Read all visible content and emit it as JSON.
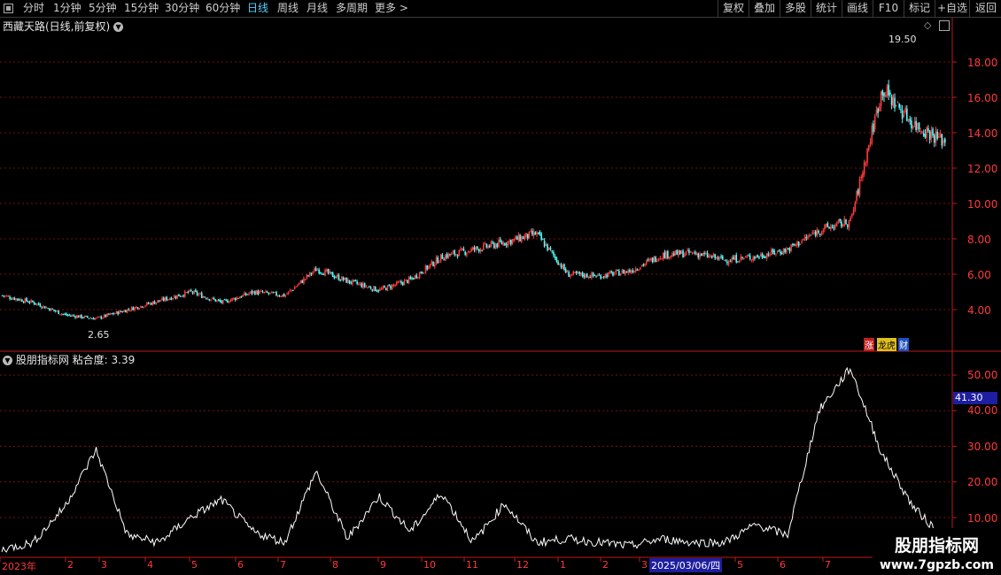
{
  "toolbar": {
    "periods": [
      "分时",
      "1分钟",
      "5分钟",
      "15分钟",
      "30分钟",
      "60分钟",
      "日线",
      "周线",
      "月线",
      "多周期",
      "更多 >"
    ],
    "active_period": "日线",
    "actions": [
      "复权",
      "叠加",
      "多股",
      "统计",
      "画线",
      "F10",
      "标记",
      "+自选",
      "返回"
    ]
  },
  "main_chart": {
    "title": "西藏天路(日线,前复权)",
    "high_label": "19.50",
    "low_label": "2.65",
    "y_ticks": [
      "18.00",
      "16.00",
      "14.00",
      "12.00",
      "10.00",
      "8.00",
      "6.00",
      "4.00"
    ],
    "badges": [
      "涨",
      "龙虎",
      "财"
    ]
  },
  "indicator": {
    "name": "股朋指标网",
    "value_text": "粘合度: 3.39",
    "current_value": "41.30",
    "y_ticks": [
      "50.00",
      "40.00",
      "30.00",
      "20.00",
      "10.00"
    ]
  },
  "time_axis": {
    "labels": [
      "2023年",
      "2",
      "3",
      "4",
      "5",
      "6",
      "7",
      "8",
      "9",
      "10",
      "11",
      "12",
      "1",
      "2",
      "3",
      "2025/03/06/四",
      "5",
      "6",
      "7"
    ]
  },
  "watermark": {
    "line1": "股朋指标网",
    "line2": "www.7gpzb.com"
  },
  "colors": {
    "up": "#ff3a3a",
    "down": "#54ffff",
    "grid": "#7a1010",
    "axis": "#c01818",
    "active": "#55d0ff",
    "highlight_bg": "#1e1ea0"
  },
  "chart_data": {
    "type": "line",
    "title": "西藏天路(日线,前复权)",
    "series": [
      {
        "name": "西藏天路",
        "x": [
          "2023-01",
          "2023-02",
          "2023-03",
          "2023-04",
          "2023-05",
          "2023-06",
          "2023-07",
          "2023-08",
          "2023-09",
          "2023-10",
          "2023-11",
          "2023-12",
          "2024-01",
          "2024-02",
          "2024-03",
          "2024-04",
          "2024-05",
          "2024-06",
          "2024-07",
          "2024-08",
          "2024-09",
          "2024-10",
          "2024-11",
          "2024-12",
          "2025-01",
          "2025-02",
          "2025-03",
          "2025-04",
          "2025-05",
          "2025-06",
          "2025-07"
        ],
        "values": [
          4.8,
          4.4,
          3.7,
          3.5,
          4.0,
          4.5,
          5.0,
          4.4,
          5.0,
          4.8,
          6.3,
          5.6,
          5.1,
          5.7,
          7.0,
          7.4,
          7.8,
          8.3,
          6.0,
          5.9,
          6.2,
          7.1,
          7.2,
          6.8,
          7.0,
          7.4,
          8.5,
          9.0,
          16.5,
          14.5,
          13.5
        ]
      },
      {
        "name": "粘合度",
        "x": [
          "2023-01",
          "2023-02",
          "2023-03",
          "2023-04",
          "2023-05",
          "2023-06",
          "2023-07",
          "2023-08",
          "2023-09",
          "2023-10",
          "2023-11",
          "2023-12",
          "2024-01",
          "2024-02",
          "2024-03",
          "2024-04",
          "2024-05",
          "2024-06",
          "2024-07",
          "2024-08",
          "2024-09",
          "2024-10",
          "2024-11",
          "2024-12",
          "2025-01",
          "2025-02",
          "2025-03",
          "2025-04",
          "2025-05",
          "2025-06",
          "2025-07"
        ],
        "values": [
          1,
          3,
          13,
          29,
          5,
          3,
          10,
          15,
          6,
          3,
          23,
          4,
          16,
          6,
          17,
          3,
          14,
          3,
          4,
          3,
          2,
          4,
          3,
          3,
          8,
          5,
          40,
          52,
          28,
          13,
          4
        ]
      }
    ],
    "ylim_price": [
      2.0,
      20.0
    ],
    "ylim_indicator": [
      0,
      55
    ]
  }
}
